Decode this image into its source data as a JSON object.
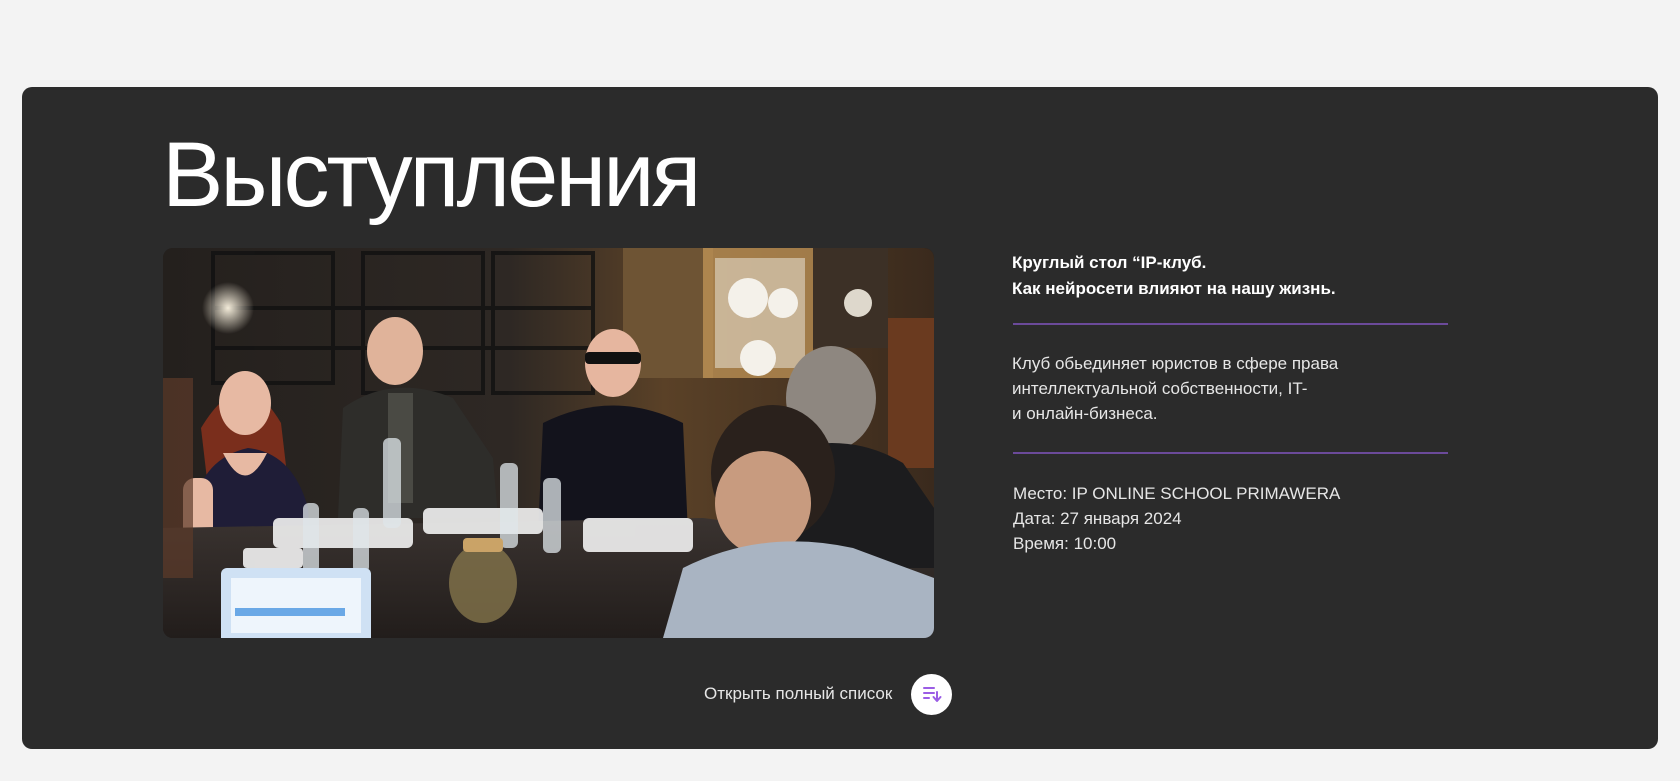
{
  "section": {
    "title": "Выступления"
  },
  "event": {
    "title": "Круглый стол “IP-клуб.\nКак нейросети влияют на нашу жизнь.",
    "description": "Клуб обьединяет юристов в сфере права\nинтеллектуальной собственности, IT-\nи онлайн-бизнеса.",
    "place": "Место: IP ONLINE SCHOOL PRIMAWERA",
    "date": "Дата: 27 января 2024",
    "time": "Время: 10:00",
    "photo_alt": "round-table-photo"
  },
  "open_list": {
    "label": "Открыть полный список",
    "icon": "playlist-down-icon"
  },
  "colors": {
    "page_bg": "#f3f3f3",
    "panel_bg": "#2b2b2b",
    "divider": "#6b4a9a",
    "icon_accent": "#9b5de5"
  }
}
